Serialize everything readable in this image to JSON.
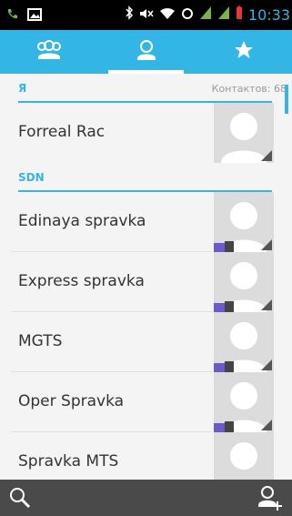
{
  "status_bar": {
    "time": "10:33",
    "colors": {
      "accent": "#33b5e5",
      "battery": "#e53935",
      "signal": "#7cb342"
    }
  },
  "tabs": [
    {
      "name": "groups",
      "icon": "groups-icon",
      "active": false
    },
    {
      "name": "contacts",
      "icon": "person-icon",
      "active": true
    },
    {
      "name": "favorites",
      "icon": "star-icon",
      "active": false
    }
  ],
  "list": {
    "sections": [
      {
        "letter": "Я",
        "count_label": "Контактов: 68",
        "items": [
          {
            "name": "Forreal Rac"
          }
        ]
      },
      {
        "letter": "SDN",
        "items": [
          {
            "name": "Edinaya spravka"
          },
          {
            "name": "Express spravka"
          },
          {
            "name": "MGTS"
          },
          {
            "name": "Oper Spravka"
          },
          {
            "name": "Spravka MTS"
          }
        ]
      }
    ]
  },
  "bottom_bar": {
    "search_icon": "search-icon",
    "add_contact_icon": "add-contact-icon"
  }
}
